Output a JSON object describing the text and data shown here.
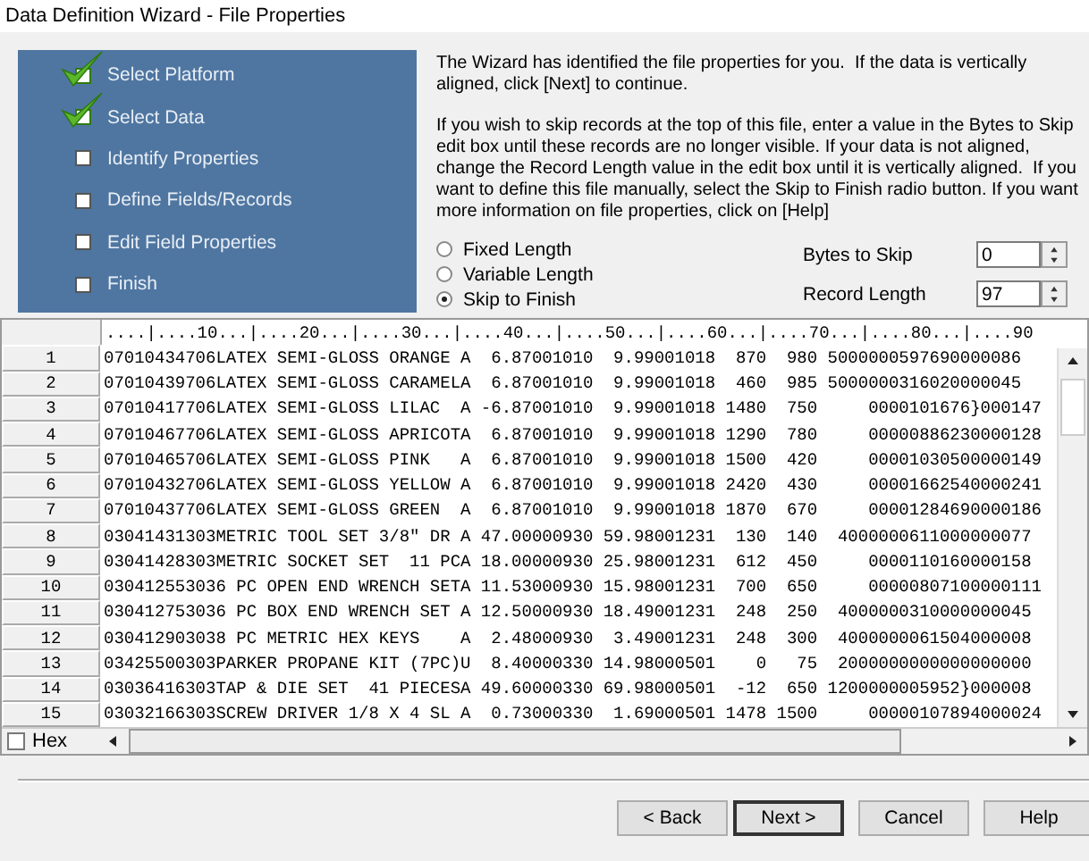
{
  "window": {
    "title": "Data Definition Wizard - File Properties"
  },
  "steps": [
    {
      "label": "Select Platform",
      "done": true
    },
    {
      "label": "Select Data",
      "done": true
    },
    {
      "label": "Identify Properties",
      "done": false
    },
    {
      "label": "Define Fields/Records",
      "done": false
    },
    {
      "label": "Edit Field Properties",
      "done": false
    },
    {
      "label": "Finish",
      "done": false
    }
  ],
  "instructions": [
    "The Wizard has identified the file properties for you.  If the data is vertically aligned, click [Next] to continue.",
    "If you wish to skip records at the top of this file, enter a value in the Bytes to Skip edit box until these records are no longer visible. If your data is not aligned, change the Record Length value in the edit box until it is vertically aligned.  If you want to define this file manually, select the Skip to Finish radio button. If you want more information on file properties, click on [Help]"
  ],
  "record_types": [
    {
      "label": "Fixed Length",
      "selected": false
    },
    {
      "label": "Variable Length",
      "selected": false
    },
    {
      "label": "Skip to Finish",
      "selected": true
    }
  ],
  "fields": [
    {
      "label": "Bytes to Skip",
      "value": "0"
    },
    {
      "label": "Record Length",
      "value": "97"
    }
  ],
  "ruler": "....|....10...|....20...|....30...|....40...|....50...|....60...|....70...|....80...|....90",
  "rows": [
    {
      "number": "1",
      "text": "07010434706LATEX SEMI-GLOSS ORANGE A  6.87001010  9.99001018  870  980 5000000597690000086"
    },
    {
      "number": "2",
      "text": "07010439706LATEX SEMI-GLOSS CARAMELA  6.87001010  9.99001018  460  985 5000000316020000045"
    },
    {
      "number": "3",
      "text": "07010417706LATEX SEMI-GLOSS LILAC  A -6.87001010  9.99001018 1480  750     0000101676}000147"
    },
    {
      "number": "4",
      "text": "07010467706LATEX SEMI-GLOSS APRICOTA  6.87001010  9.99001018 1290  780     00000886230000128"
    },
    {
      "number": "5",
      "text": "07010465706LATEX SEMI-GLOSS PINK   A  6.87001010  9.99001018 1500  420     00001030500000149"
    },
    {
      "number": "6",
      "text": "07010432706LATEX SEMI-GLOSS YELLOW A  6.87001010  9.99001018 2420  430     00001662540000241"
    },
    {
      "number": "7",
      "text": "07010437706LATEX SEMI-GLOSS GREEN  A  6.87001010  9.99001018 1870  670     00001284690000186"
    },
    {
      "number": "8",
      "text": "03041431303METRIC TOOL SET 3/8\" DR A 47.00000930 59.98001231  130  140  4000000611000000077"
    },
    {
      "number": "9",
      "text": "03041428303METRIC SOCKET SET  11 PCA 18.00000930 25.98001231  612  450     0000110160000158"
    },
    {
      "number": "10",
      "text": "030412553036 PC OPEN END WRENCH SETA 11.53000930 15.98001231  700  650     00000807100000111"
    },
    {
      "number": "11",
      "text": "030412753036 PC BOX END WRENCH SET A 12.50000930 18.49001231  248  250  4000000310000000045"
    },
    {
      "number": "12",
      "text": "030412903038 PC METRIC HEX KEYS    A  2.48000930  3.49001231  248  300  4000000061504000008"
    },
    {
      "number": "13",
      "text": "03425500303PARKER PROPANE KIT (7PC)U  8.40000330 14.98000501    0   75  2000000000000000000"
    },
    {
      "number": "14",
      "text": "03036416303TAP & DIE SET  41 PIECESA 49.60000330 69.98000501  -12  650 1200000005952}000008"
    },
    {
      "number": "15",
      "text": "03032166303SCREW DRIVER 1/8 X 4 SL A  0.73000330  1.69000501 1478 1500     00000107894000024"
    }
  ],
  "hex": {
    "label": "Hex",
    "checked": false
  },
  "buttons": [
    {
      "label": "< Back",
      "default": false
    },
    {
      "label": "Next >",
      "default": true
    },
    {
      "label": "Cancel",
      "default": false
    },
    {
      "label": "Help",
      "default": false
    }
  ]
}
